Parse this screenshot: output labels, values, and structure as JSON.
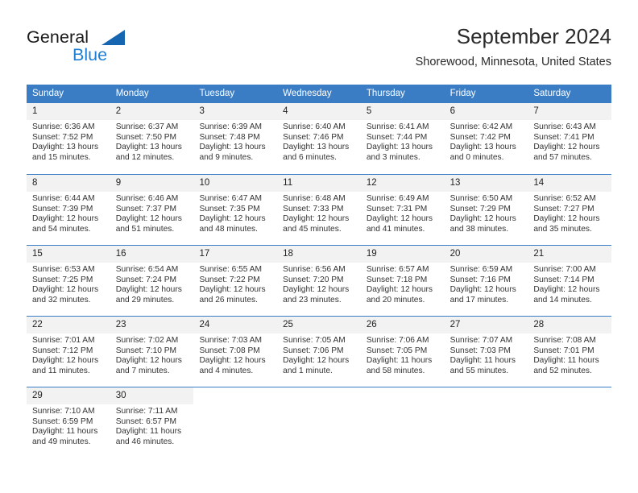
{
  "brand": {
    "name_part1": "General",
    "name_part2": "Blue",
    "accent_color": "#1f7fd4",
    "triangle_color": "#1565b0"
  },
  "header": {
    "title": "September 2024",
    "subtitle": "Shorewood, Minnesota, United States"
  },
  "calendar": {
    "header_color": "#3b7dc4",
    "daynum_band_color": "#f2f2f2",
    "weekdays": [
      "Sunday",
      "Monday",
      "Tuesday",
      "Wednesday",
      "Thursday",
      "Friday",
      "Saturday"
    ],
    "weeks": [
      [
        {
          "day": "1",
          "lines": [
            "Sunrise: 6:36 AM",
            "Sunset: 7:52 PM",
            "Daylight: 13 hours",
            "and 15 minutes."
          ]
        },
        {
          "day": "2",
          "lines": [
            "Sunrise: 6:37 AM",
            "Sunset: 7:50 PM",
            "Daylight: 13 hours",
            "and 12 minutes."
          ]
        },
        {
          "day": "3",
          "lines": [
            "Sunrise: 6:39 AM",
            "Sunset: 7:48 PM",
            "Daylight: 13 hours",
            "and 9 minutes."
          ]
        },
        {
          "day": "4",
          "lines": [
            "Sunrise: 6:40 AM",
            "Sunset: 7:46 PM",
            "Daylight: 13 hours",
            "and 6 minutes."
          ]
        },
        {
          "day": "5",
          "lines": [
            "Sunrise: 6:41 AM",
            "Sunset: 7:44 PM",
            "Daylight: 13 hours",
            "and 3 minutes."
          ]
        },
        {
          "day": "6",
          "lines": [
            "Sunrise: 6:42 AM",
            "Sunset: 7:42 PM",
            "Daylight: 13 hours",
            "and 0 minutes."
          ]
        },
        {
          "day": "7",
          "lines": [
            "Sunrise: 6:43 AM",
            "Sunset: 7:41 PM",
            "Daylight: 12 hours",
            "and 57 minutes."
          ]
        }
      ],
      [
        {
          "day": "8",
          "lines": [
            "Sunrise: 6:44 AM",
            "Sunset: 7:39 PM",
            "Daylight: 12 hours",
            "and 54 minutes."
          ]
        },
        {
          "day": "9",
          "lines": [
            "Sunrise: 6:46 AM",
            "Sunset: 7:37 PM",
            "Daylight: 12 hours",
            "and 51 minutes."
          ]
        },
        {
          "day": "10",
          "lines": [
            "Sunrise: 6:47 AM",
            "Sunset: 7:35 PM",
            "Daylight: 12 hours",
            "and 48 minutes."
          ]
        },
        {
          "day": "11",
          "lines": [
            "Sunrise: 6:48 AM",
            "Sunset: 7:33 PM",
            "Daylight: 12 hours",
            "and 45 minutes."
          ]
        },
        {
          "day": "12",
          "lines": [
            "Sunrise: 6:49 AM",
            "Sunset: 7:31 PM",
            "Daylight: 12 hours",
            "and 41 minutes."
          ]
        },
        {
          "day": "13",
          "lines": [
            "Sunrise: 6:50 AM",
            "Sunset: 7:29 PM",
            "Daylight: 12 hours",
            "and 38 minutes."
          ]
        },
        {
          "day": "14",
          "lines": [
            "Sunrise: 6:52 AM",
            "Sunset: 7:27 PM",
            "Daylight: 12 hours",
            "and 35 minutes."
          ]
        }
      ],
      [
        {
          "day": "15",
          "lines": [
            "Sunrise: 6:53 AM",
            "Sunset: 7:25 PM",
            "Daylight: 12 hours",
            "and 32 minutes."
          ]
        },
        {
          "day": "16",
          "lines": [
            "Sunrise: 6:54 AM",
            "Sunset: 7:24 PM",
            "Daylight: 12 hours",
            "and 29 minutes."
          ]
        },
        {
          "day": "17",
          "lines": [
            "Sunrise: 6:55 AM",
            "Sunset: 7:22 PM",
            "Daylight: 12 hours",
            "and 26 minutes."
          ]
        },
        {
          "day": "18",
          "lines": [
            "Sunrise: 6:56 AM",
            "Sunset: 7:20 PM",
            "Daylight: 12 hours",
            "and 23 minutes."
          ]
        },
        {
          "day": "19",
          "lines": [
            "Sunrise: 6:57 AM",
            "Sunset: 7:18 PM",
            "Daylight: 12 hours",
            "and 20 minutes."
          ]
        },
        {
          "day": "20",
          "lines": [
            "Sunrise: 6:59 AM",
            "Sunset: 7:16 PM",
            "Daylight: 12 hours",
            "and 17 minutes."
          ]
        },
        {
          "day": "21",
          "lines": [
            "Sunrise: 7:00 AM",
            "Sunset: 7:14 PM",
            "Daylight: 12 hours",
            "and 14 minutes."
          ]
        }
      ],
      [
        {
          "day": "22",
          "lines": [
            "Sunrise: 7:01 AM",
            "Sunset: 7:12 PM",
            "Daylight: 12 hours",
            "and 11 minutes."
          ]
        },
        {
          "day": "23",
          "lines": [
            "Sunrise: 7:02 AM",
            "Sunset: 7:10 PM",
            "Daylight: 12 hours",
            "and 7 minutes."
          ]
        },
        {
          "day": "24",
          "lines": [
            "Sunrise: 7:03 AM",
            "Sunset: 7:08 PM",
            "Daylight: 12 hours",
            "and 4 minutes."
          ]
        },
        {
          "day": "25",
          "lines": [
            "Sunrise: 7:05 AM",
            "Sunset: 7:06 PM",
            "Daylight: 12 hours",
            "and 1 minute."
          ]
        },
        {
          "day": "26",
          "lines": [
            "Sunrise: 7:06 AM",
            "Sunset: 7:05 PM",
            "Daylight: 11 hours",
            "and 58 minutes."
          ]
        },
        {
          "day": "27",
          "lines": [
            "Sunrise: 7:07 AM",
            "Sunset: 7:03 PM",
            "Daylight: 11 hours",
            "and 55 minutes."
          ]
        },
        {
          "day": "28",
          "lines": [
            "Sunrise: 7:08 AM",
            "Sunset: 7:01 PM",
            "Daylight: 11 hours",
            "and 52 minutes."
          ]
        }
      ],
      [
        {
          "day": "29",
          "lines": [
            "Sunrise: 7:10 AM",
            "Sunset: 6:59 PM",
            "Daylight: 11 hours",
            "and 49 minutes."
          ]
        },
        {
          "day": "30",
          "lines": [
            "Sunrise: 7:11 AM",
            "Sunset: 6:57 PM",
            "Daylight: 11 hours",
            "and 46 minutes."
          ]
        },
        {
          "day": "",
          "lines": []
        },
        {
          "day": "",
          "lines": []
        },
        {
          "day": "",
          "lines": []
        },
        {
          "day": "",
          "lines": []
        },
        {
          "day": "",
          "lines": []
        }
      ]
    ]
  }
}
